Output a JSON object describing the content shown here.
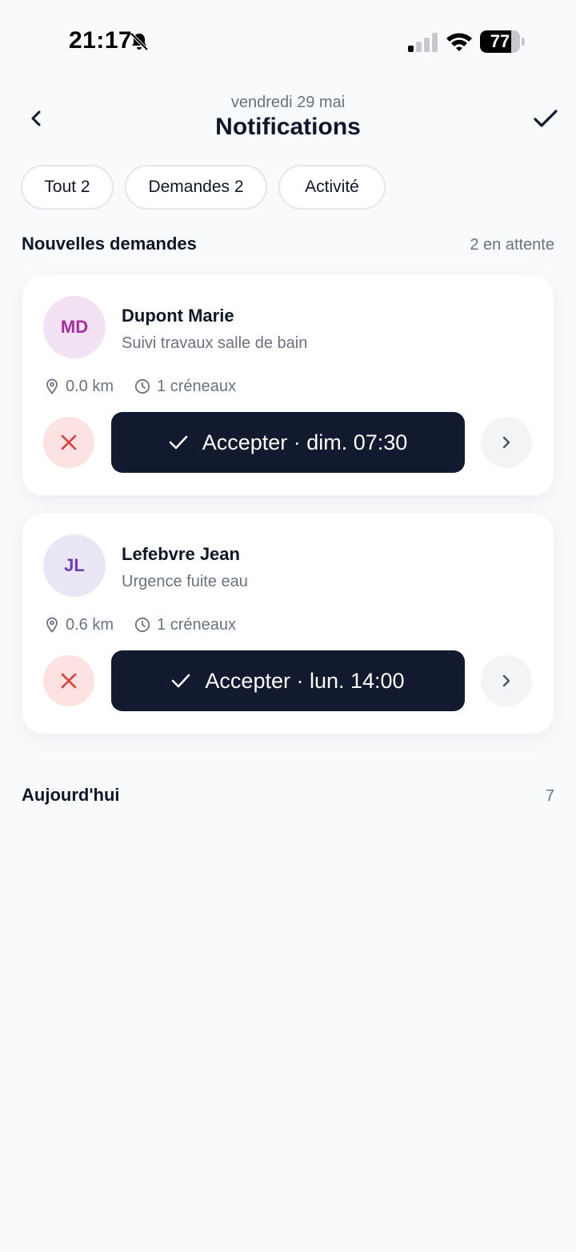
{
  "status_bar": {
    "time": "21:17",
    "battery": "77",
    "battery_level": 0.77,
    "icons": [
      "bell-slash-icon",
      "cellular-signal-icon",
      "wifi-icon",
      "battery-icon"
    ]
  },
  "header": {
    "date": "vendredi 29 mai",
    "title": "Notifications",
    "back_icon": "chevron-left-icon",
    "done_icon": "checkmark-icon"
  },
  "tabs": [
    {
      "label": "Tout 2",
      "active": true
    },
    {
      "label": "Demandes 2",
      "active": false
    },
    {
      "label": "Activité",
      "active": false
    }
  ],
  "new_requests": {
    "title": "Nouvelles demandes",
    "meta": "2 en attente",
    "cards": [
      {
        "initials": "MD",
        "avatar_bg": "#f3e2f3",
        "avatar_color": "#a72fa0",
        "name": "Dupont Marie",
        "subtitle": "Suivi travaux salle de bain",
        "distance": "0.0 km",
        "slots": "1 créneaux",
        "accept_label": "Accepter · dim. 07:30"
      },
      {
        "initials": "JL",
        "avatar_bg": "#ebe6f6",
        "avatar_color": "#6c3dbf",
        "name": "Lefebvre Jean",
        "subtitle": "Urgence fuite eau",
        "distance": "0.6 km",
        "slots": "1 créneaux",
        "accept_label": "Accepter · lun. 14:00"
      }
    ]
  },
  "today": {
    "title": "Aujourd'hui",
    "count": "7"
  },
  "colors": {
    "background": "#f8fafc",
    "primary_dark": "#111a2e",
    "reject_bg": "#fde2e2",
    "reject_icon": "#e03b3b"
  }
}
